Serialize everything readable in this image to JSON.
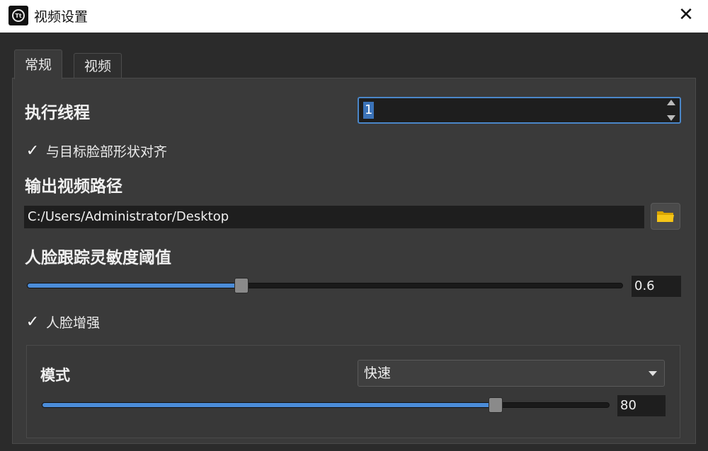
{
  "window": {
    "title": "视频设置",
    "app_icon_text": "Tt"
  },
  "tabs": [
    {
      "label": "常规",
      "active": true
    },
    {
      "label": "视频",
      "active": false
    }
  ],
  "general": {
    "threads_label": "执行线程",
    "threads_value": "1",
    "align_checkbox": {
      "label": "与目标脸部形状对齐",
      "checked": true
    },
    "output_path_label": "输出视频路径",
    "output_path_value": "C:/Users/Administrator/Desktop",
    "tracking_label": "人脸跟踪灵敏度阈值",
    "tracking_value": "0.6",
    "tracking_fraction": 0.36,
    "enhance_checkbox": {
      "label": "人脸增强",
      "checked": true
    },
    "mode_label": "模式",
    "mode_selected": "快速",
    "mode_strength_value": "80",
    "mode_strength_fraction": 0.8
  },
  "colors": {
    "accent": "#4b8cd8",
    "background": "#2b2b2b",
    "titlebar": "#ffffff",
    "folder": "#f5c518"
  },
  "icons": {
    "close": "close-icon",
    "folder": "folder-icon",
    "check": "checkmark-icon",
    "spin_up": "arrow-up-icon",
    "spin_down": "arrow-down-icon",
    "dropdown": "chevron-down-icon"
  }
}
